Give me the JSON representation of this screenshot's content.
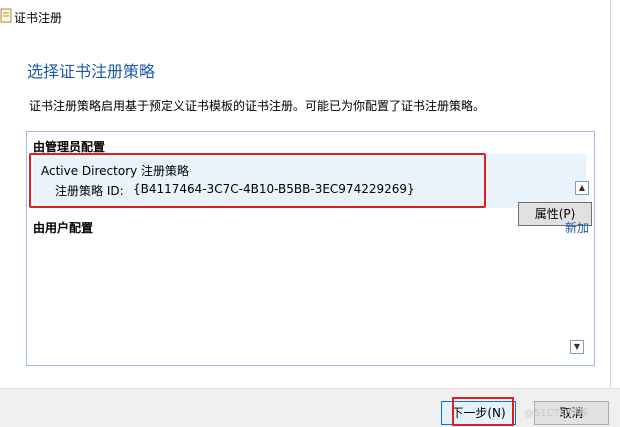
{
  "window": {
    "title": "证书注册"
  },
  "page": {
    "title": "选择证书注册策略",
    "description": "证书注册策略启用基于预定义证书模板的证书注册。可能已为你配置了证书注册策略。"
  },
  "policies": {
    "admin_group_label": "由管理员配置",
    "selected_policy": {
      "name": "Active Directory 注册策略",
      "id_label": "注册策略 ID:",
      "id_value": "{B4117464-3C7C-4B10-B5BB-3EC974229269}"
    },
    "properties_button": "属性(P)",
    "user_group_label": "由用户配置",
    "add_link": "新加"
  },
  "footer": {
    "next_button": "下一步(N)",
    "cancel_button": "取消"
  },
  "watermark": "@51CTO博客",
  "icons": [
    "certificate-icon",
    "chevron-up-icon",
    "chevron-down-icon"
  ],
  "colors": {
    "accent": "#1e5aa8",
    "selection": "#e8f3fc",
    "annotation": "#e02020"
  }
}
